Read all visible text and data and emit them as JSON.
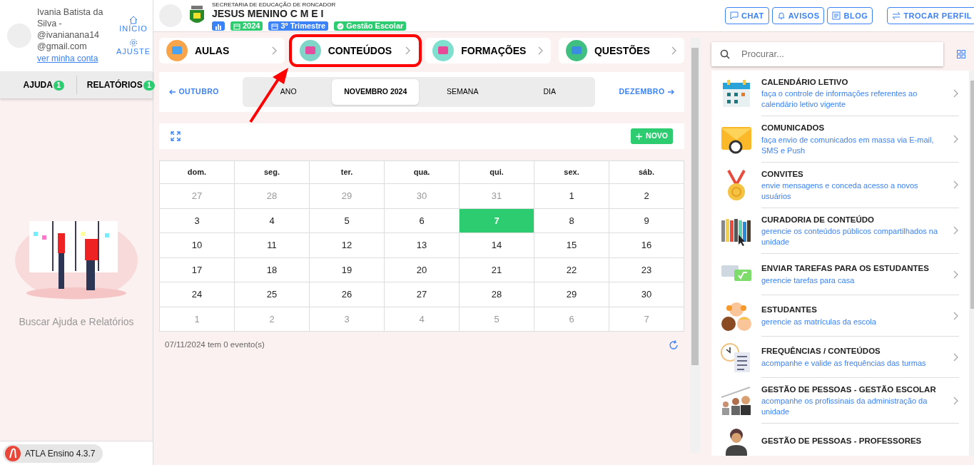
{
  "user": {
    "name": "Ivania Batista da Silva - @ivanianana14 @gmail.com",
    "account_link": "ver minha conta"
  },
  "user_links": [
    {
      "label": "INÍCIO",
      "kind": "home"
    },
    {
      "label": "AJUSTE",
      "kind": "settings"
    }
  ],
  "sidebar_tabs": [
    {
      "label": "AJUDA",
      "count": "1"
    },
    {
      "label": "RELATÓRIOS",
      "count": "1"
    }
  ],
  "sidebar_empty_text": "Buscar Ajuda e Relatórios",
  "version": "ATLA Ensino 4.3.7",
  "school": {
    "secretariat": "SECRETARIA DE EDUCAÇÃO DE RONCADOR",
    "name": "JESUS MENINO C M E I"
  },
  "badges": [
    {
      "kind": "chart",
      "color": "#3b82f6"
    },
    {
      "kind": "calendar",
      "label": "2024",
      "color": "#2ecc71"
    },
    {
      "kind": "calendar",
      "label": "3º Trimestre",
      "color": "#3b82f6"
    },
    {
      "kind": "check",
      "label": "Gestão Escolar",
      "color": "#2ecc71"
    }
  ],
  "header_buttons": [
    {
      "label": "CHAT",
      "kind": "chat"
    },
    {
      "label": "AVISOS",
      "kind": "bell"
    },
    {
      "label": "BLOG",
      "kind": "news"
    },
    {
      "label": "TROCAR PERFIL",
      "kind": "swap"
    }
  ],
  "modules": [
    {
      "label": "AULAS",
      "highlighted": false
    },
    {
      "label": "CONTEÚDOS",
      "highlighted": true
    },
    {
      "label": "FORMAÇÕES",
      "highlighted": false
    },
    {
      "label": "QUESTÕES",
      "highlighted": false
    }
  ],
  "calendar": {
    "prev": "OUTUBRO",
    "next": "DEZEMBRO",
    "views": [
      {
        "label": "ANO",
        "selected": false
      },
      {
        "label": "NOVEMBRO 2024",
        "selected": true
      },
      {
        "label": "SEMANA",
        "selected": false
      },
      {
        "label": "DIA",
        "selected": false
      }
    ],
    "new_button": "NOVO",
    "weekdays": [
      "dom.",
      "seg.",
      "ter.",
      "qua.",
      "qui.",
      "sex.",
      "sáb."
    ],
    "weeks": [
      [
        {
          "day": "27",
          "muted": true,
          "selected": false
        },
        {
          "day": "28",
          "muted": true,
          "selected": false
        },
        {
          "day": "29",
          "muted": true,
          "selected": false
        },
        {
          "day": "30",
          "muted": true,
          "selected": false
        },
        {
          "day": "31",
          "muted": true,
          "selected": false
        },
        {
          "day": "1",
          "muted": false,
          "selected": false
        },
        {
          "day": "2",
          "muted": false,
          "selected": false
        }
      ],
      [
        {
          "day": "3",
          "muted": false,
          "selected": false
        },
        {
          "day": "4",
          "muted": false,
          "selected": false
        },
        {
          "day": "5",
          "muted": false,
          "selected": false
        },
        {
          "day": "6",
          "muted": false,
          "selected": false
        },
        {
          "day": "7",
          "muted": false,
          "selected": true
        },
        {
          "day": "8",
          "muted": false,
          "selected": false
        },
        {
          "day": "9",
          "muted": false,
          "selected": false
        }
      ],
      [
        {
          "day": "10",
          "muted": false,
          "selected": false
        },
        {
          "day": "11",
          "muted": false,
          "selected": false
        },
        {
          "day": "12",
          "muted": false,
          "selected": false
        },
        {
          "day": "13",
          "muted": false,
          "selected": false
        },
        {
          "day": "14",
          "muted": false,
          "selected": false
        },
        {
          "day": "15",
          "muted": false,
          "selected": false
        },
        {
          "day": "16",
          "muted": false,
          "selected": false
        }
      ],
      [
        {
          "day": "17",
          "muted": false,
          "selected": false
        },
        {
          "day": "18",
          "muted": false,
          "selected": false
        },
        {
          "day": "19",
          "muted": false,
          "selected": false
        },
        {
          "day": "20",
          "muted": false,
          "selected": false
        },
        {
          "day": "21",
          "muted": false,
          "selected": false
        },
        {
          "day": "22",
          "muted": false,
          "selected": false
        },
        {
          "day": "23",
          "muted": false,
          "selected": false
        }
      ],
      [
        {
          "day": "24",
          "muted": false,
          "selected": false
        },
        {
          "day": "25",
          "muted": false,
          "selected": false
        },
        {
          "day": "26",
          "muted": false,
          "selected": false
        },
        {
          "day": "27",
          "muted": false,
          "selected": false
        },
        {
          "day": "28",
          "muted": false,
          "selected": false
        },
        {
          "day": "29",
          "muted": false,
          "selected": false
        },
        {
          "day": "30",
          "muted": false,
          "selected": false
        }
      ],
      [
        {
          "day": "1",
          "muted": true,
          "selected": false
        },
        {
          "day": "2",
          "muted": true,
          "selected": false
        },
        {
          "day": "3",
          "muted": true,
          "selected": false
        },
        {
          "day": "4",
          "muted": true,
          "selected": false
        },
        {
          "day": "5",
          "muted": true,
          "selected": false
        },
        {
          "day": "6",
          "muted": true,
          "selected": false
        },
        {
          "day": "7",
          "muted": true,
          "selected": false
        }
      ]
    ],
    "status": "07/11/2024 tem 0 evento(s)"
  },
  "search": {
    "placeholder": "Procurar..."
  },
  "features": [
    {
      "title": "CALENDÁRIO LETIVO",
      "description": "faça o controle de informações referentes ao calendário letivo vigente"
    },
    {
      "title": "COMUNICADOS",
      "description": "faça envio de comunicados em massa via E-mail, SMS e Push"
    },
    {
      "title": "CONVITES",
      "description": "envie mensagens e conceda acesso a novos usuários"
    },
    {
      "title": "CURADORIA DE CONTEÚDO",
      "description": "gerencie os conteúdos públicos compartilhados na unidade"
    },
    {
      "title": "ENVIAR TAREFAS PARA OS ESTUDANTES",
      "description": "gerencie tarefas para casa"
    },
    {
      "title": "ESTUDANTES",
      "description": "gerencie as matrículas da escola"
    },
    {
      "title": "FREQUÊNCIAS / CONTEÚDOS",
      "description": "acompanhe e valide as frequências das turmas"
    },
    {
      "title": "GESTÃO DE PESSOAS - GESTÃO ESCOLAR",
      "description": "acompanhe os profissinais da administração da unidade"
    },
    {
      "title": "GESTÃO DE PESSOAS - PROFESSORES"
    }
  ]
}
